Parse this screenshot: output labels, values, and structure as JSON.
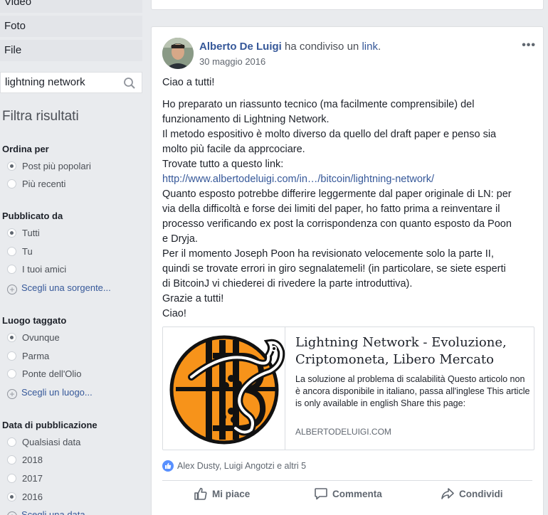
{
  "sidebar": {
    "nav_items": [
      {
        "label": "Video"
      },
      {
        "label": "Foto"
      },
      {
        "label": "File"
      }
    ],
    "search": {
      "value": "lightning network"
    },
    "filter_title": "Filtra risultati",
    "sections": [
      {
        "title": "Ordina per",
        "options": [
          "Post più popolari",
          "Più recenti"
        ],
        "selected": 0
      },
      {
        "title": "Pubblicato da",
        "options": [
          "Tutti",
          "Tu",
          "I tuoi amici"
        ],
        "selected": 0,
        "add_link": "Scegli una sorgente..."
      },
      {
        "title": "Luogo taggato",
        "options": [
          "Ovunque",
          "Parma",
          "Ponte dell'Olio"
        ],
        "selected": 0,
        "add_link": "Scegli un luogo..."
      },
      {
        "title": "Data di pubblicazione",
        "options": [
          "Qualsiasi data",
          "2018",
          "2017",
          "2016"
        ],
        "selected": 3,
        "add_link": "Scegli una data..."
      }
    ]
  },
  "post": {
    "author": "Alberto De Luigi",
    "shared_text": "ha condiviso un",
    "link_word": "link",
    "period": ".",
    "date": "30 maggio 2016",
    "more_icon": "more-horizontal-icon",
    "text": {
      "greeting": "Ciao a tutti!",
      "lines": [
        "Ho preparato un riassunto tecnico (ma facilmente comprensibile) del",
        "funzionamento di Lightning Network.",
        "Il metodo espositivo è molto diverso da quello del draft paper e penso sia",
        "molto più facile da apprcociare.",
        "Trovate tutto a questo link:"
      ],
      "url": "http://www.albertodeluigi.com/in…/bitcoin/lightning-network/",
      "lines2": [
        "Quanto esposto potrebbe differire leggermente dal paper originale di LN: per",
        "via della difficoltà e forse dei limiti del paper, ho fatto prima a reinventare il",
        "processo verificando ex post la corrispondenza con quanto esposto da Poon",
        "e Dryja.",
        "Per il momento Joseph Poon ha revisionato velocemente solo la parte II,",
        "quindi se trovate errori in giro segnalatemeli! (in particolare, se siete esperti",
        "di BitcoinJ vi chiederei di rivedere la parte introduttiva).",
        "Grazie a tutti!",
        "Ciao!"
      ]
    },
    "preview": {
      "title": "Lightning Network - Evoluzione, Criptomoneta, Libero Mercato",
      "description": "La soluzione al problema di scalabilità Questo articolo non è ancora disponibile in italiano, passa all'inglese This article is only available in english Share this page:",
      "domain": "ALBERTODELUIGI.COM"
    },
    "reactions": "Alex Dusty, Luigi Angotzi e altri 5",
    "actions": {
      "like": "Mi piace",
      "comment": "Commenta",
      "share": "Condividi"
    }
  },
  "colors": {
    "link": "#365899",
    "like_badge": "#5890ff",
    "logo_orange": "#f7931a",
    "page_bg": "#e9ebee"
  }
}
